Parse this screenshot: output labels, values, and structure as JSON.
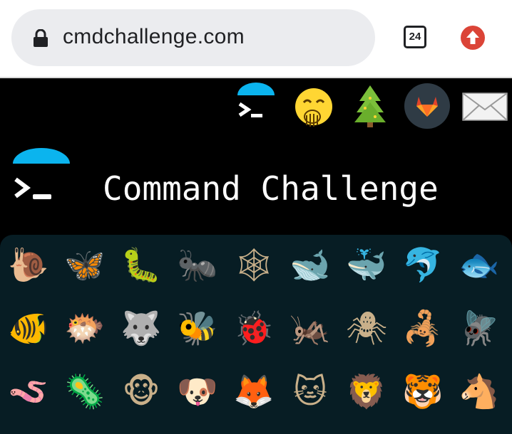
{
  "browser": {
    "url": "cmdchallenge.com",
    "tab_count": "24"
  },
  "header_icons": [
    {
      "name": "terminal-logo-icon"
    },
    {
      "name": "hand-over-mouth-emoji-icon"
    },
    {
      "name": "tree-icon"
    },
    {
      "name": "gitlab-icon"
    },
    {
      "name": "envelope-icon"
    }
  ],
  "site": {
    "title": "Command Challenge"
  },
  "animals": [
    {
      "name": "snail-icon",
      "glyph": "🐌"
    },
    {
      "name": "butterfly-icon",
      "glyph": "🦋"
    },
    {
      "name": "caterpillar-icon",
      "glyph": "🐛"
    },
    {
      "name": "ant-icon",
      "glyph": "🐜"
    },
    {
      "name": "spider-web-icon",
      "glyph": "🕸"
    },
    {
      "name": "whale-icon",
      "glyph": "🐋"
    },
    {
      "name": "spouting-whale-icon",
      "glyph": "🐳"
    },
    {
      "name": "dolphin-icon",
      "glyph": "🐬"
    },
    {
      "name": "fish-icon",
      "glyph": "🐟"
    },
    {
      "name": "tropical-fish-icon",
      "glyph": "🐠"
    },
    {
      "name": "blowfish-icon",
      "glyph": "🐡"
    },
    {
      "name": "wolf-icon",
      "glyph": "🐺"
    },
    {
      "name": "bee-icon",
      "glyph": "🐝"
    },
    {
      "name": "ladybug-icon",
      "glyph": "🐞"
    },
    {
      "name": "cricket-icon",
      "glyph": "🦗"
    },
    {
      "name": "spider-icon",
      "glyph": "🕷"
    },
    {
      "name": "scorpion-icon",
      "glyph": "🦂"
    },
    {
      "name": "fly-icon",
      "glyph": "🪰"
    },
    {
      "name": "worm-icon",
      "glyph": "🪱"
    },
    {
      "name": "microbe-icon",
      "glyph": "🦠"
    },
    {
      "name": "monkey-face-icon",
      "glyph": "🐵"
    },
    {
      "name": "dog-face-icon",
      "glyph": "🐶"
    },
    {
      "name": "fox-icon",
      "glyph": "🦊"
    },
    {
      "name": "cat-face-icon",
      "glyph": "🐱"
    },
    {
      "name": "lion-icon",
      "glyph": "🦁"
    },
    {
      "name": "tiger-face-icon",
      "glyph": "🐯"
    },
    {
      "name": "horse-face-icon",
      "glyph": "🐴"
    }
  ]
}
